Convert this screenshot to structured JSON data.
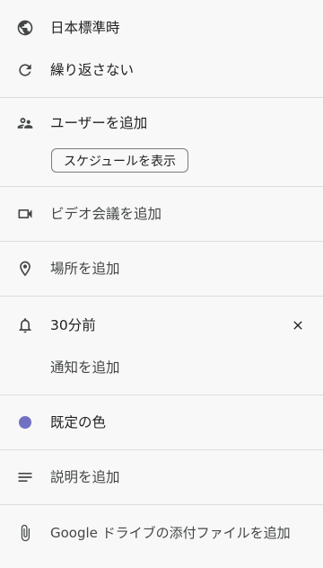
{
  "timezone": {
    "label": "日本標準時",
    "icon": "globe-icon"
  },
  "repeat": {
    "label": "繰り返さない",
    "icon": "repeat-icon"
  },
  "guests": {
    "label": "ユーザーを追加",
    "icon": "people-icon",
    "schedule_button": "スケジュールを表示"
  },
  "video": {
    "label": "ビデオ会議を追加",
    "icon": "videocam-icon"
  },
  "location": {
    "label": "場所を追加",
    "icon": "location-pin-icon"
  },
  "notification": {
    "label": "30分前",
    "add_label": "通知を追加",
    "icon": "bell-icon",
    "remove_icon": "close-icon"
  },
  "color": {
    "label": "既定の色",
    "value": "#7270c2"
  },
  "description": {
    "label": "説明を追加",
    "icon": "notes-icon"
  },
  "attachment": {
    "label": "Google ドライブの添付ファイルを追加",
    "icon": "paperclip-icon"
  }
}
